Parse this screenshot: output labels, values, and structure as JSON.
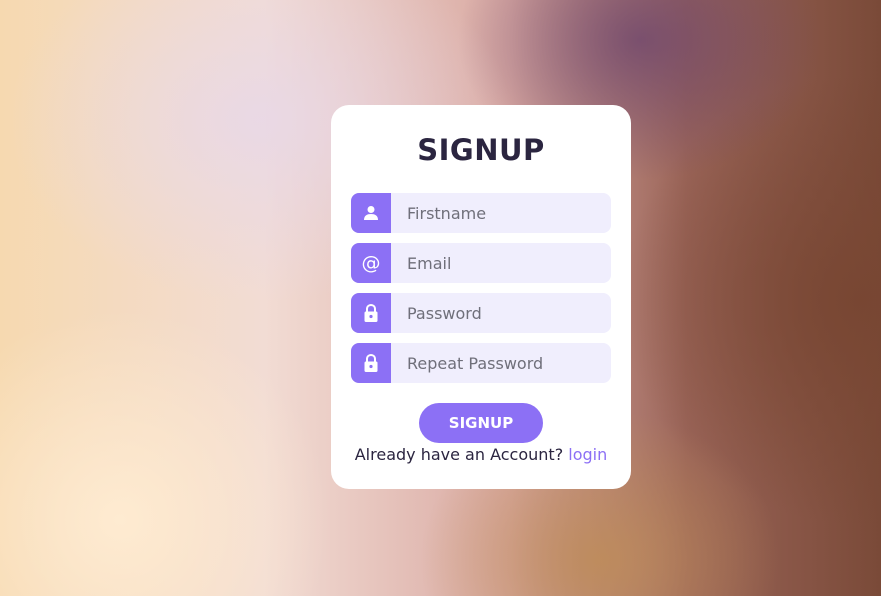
{
  "form": {
    "title": "SIGNUP",
    "fields": [
      {
        "icon": "user-icon",
        "placeholder": "Firstname",
        "value": ""
      },
      {
        "icon": "at-sign-icon",
        "placeholder": "Email",
        "value": ""
      },
      {
        "icon": "lock-icon",
        "placeholder": "Password",
        "value": ""
      },
      {
        "icon": "lock-icon",
        "placeholder": "Repeat Password",
        "value": ""
      }
    ],
    "at_symbol": "@",
    "submit_label": "SIGNUP",
    "footer_text": "Already have an Account?",
    "login_link": "login"
  },
  "colors": {
    "accent": "#8c70f5",
    "field_background": "#f0eefd",
    "title_text": "#2b2540",
    "card_background": "#ffffff"
  }
}
